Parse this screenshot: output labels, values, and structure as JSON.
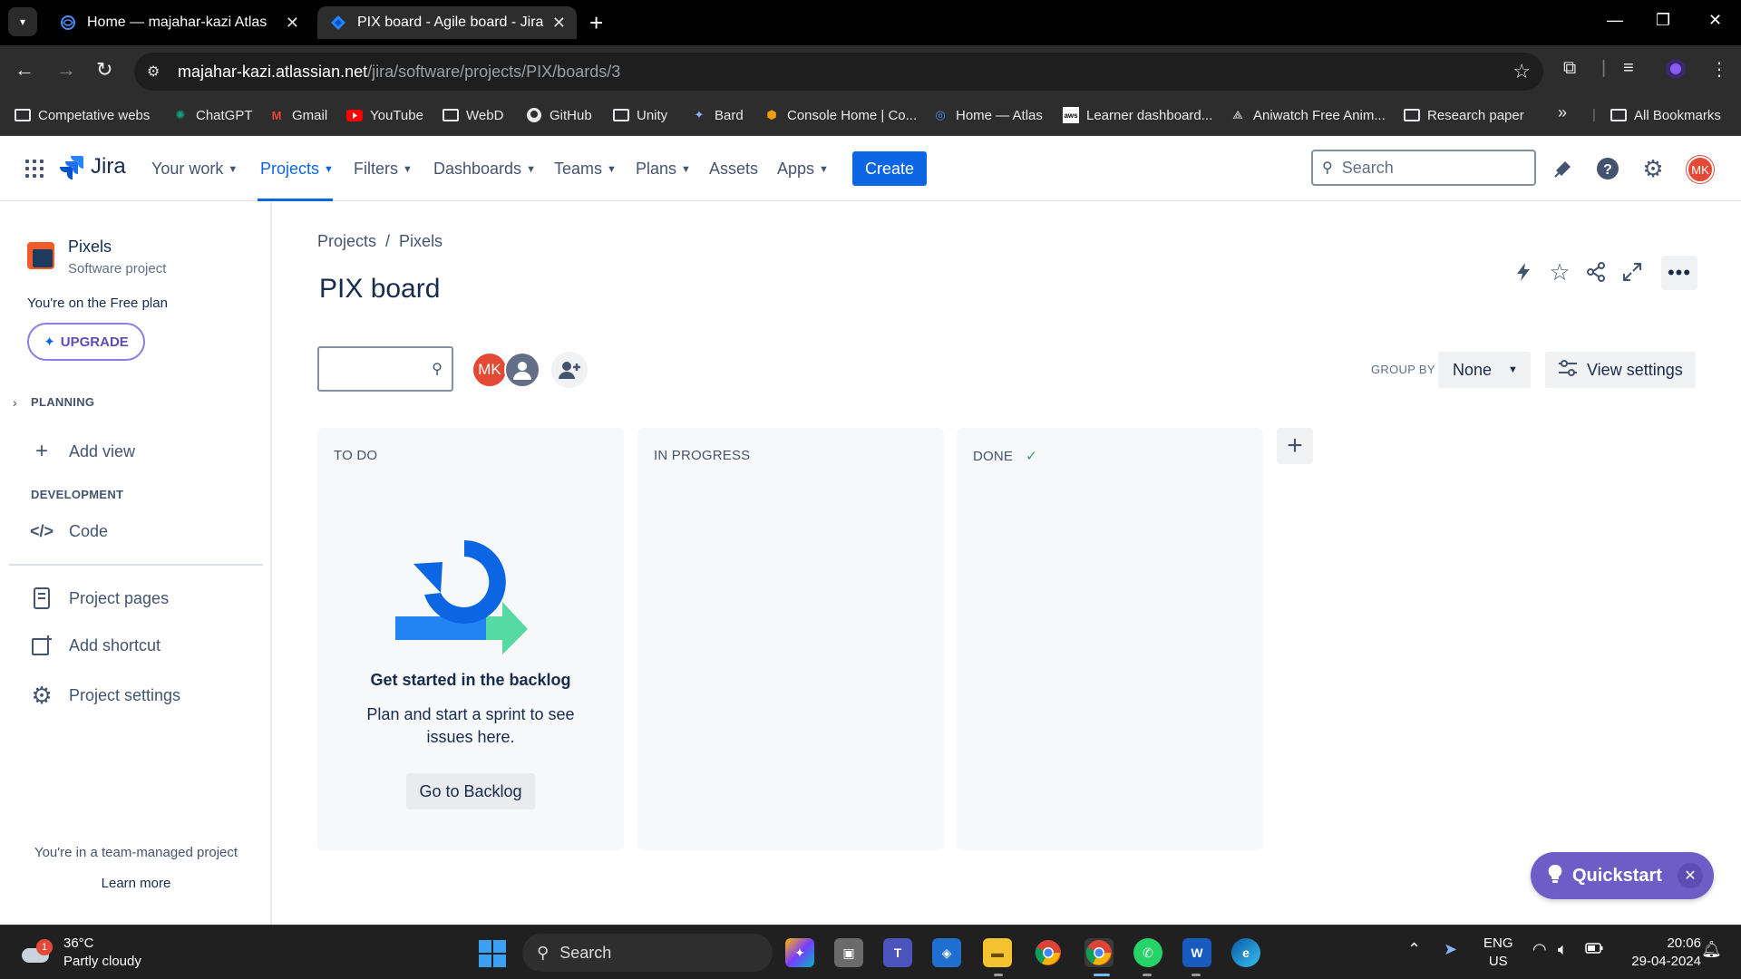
{
  "browser": {
    "tabs": [
      {
        "title": "Home — majahar-kazi Atlas",
        "active": false
      },
      {
        "title": "PIX board - Agile board - Jira",
        "active": true
      }
    ],
    "url_host": "majahar-kazi.atlassian.net",
    "url_path": "/jira/software/projects/PIX/boards/3",
    "bookmarks": [
      "Competative webs",
      "ChatGPT",
      "Gmail",
      "YouTube",
      "WebD",
      "GitHub",
      "Unity",
      "Bard",
      "Console Home | Co...",
      "Home — Atlas",
      "Learner dashboard...",
      "Aniwatch Free Anim...",
      "Research paper",
      "All Bookmarks"
    ],
    "bookmark_overflow": "»"
  },
  "jira_nav": {
    "logo": "Jira",
    "items": [
      "Your work",
      "Projects",
      "Filters",
      "Dashboards",
      "Teams",
      "Plans",
      "Assets",
      "Apps"
    ],
    "active_item": "Projects",
    "create_label": "Create",
    "search_placeholder": "Search",
    "avatar_initials": "MK"
  },
  "sidebar": {
    "project_name": "Pixels",
    "project_type": "Software project",
    "plan_text": "You're on the Free plan",
    "upgrade_label": "UPGRADE",
    "planning_header": "PLANNING",
    "add_view": "Add view",
    "development_header": "DEVELOPMENT",
    "code": "Code",
    "project_pages": "Project pages",
    "add_shortcut": "Add shortcut",
    "project_settings": "Project settings",
    "team_note": "You're in a team-managed project",
    "learn_more": "Learn more"
  },
  "main": {
    "breadcrumb": [
      "Projects",
      "Pixels"
    ],
    "title": "PIX board",
    "avatar_initials": "MK",
    "group_by_label": "GROUP BY",
    "group_by_value": "None",
    "view_settings": "View settings",
    "columns": [
      {
        "title": "TO DO",
        "done": false
      },
      {
        "title": "IN PROGRESS",
        "done": false
      },
      {
        "title": "DONE",
        "done": true
      }
    ],
    "empty_state": {
      "title": "Get started in the backlog",
      "description": "Plan and start a sprint to see issues here.",
      "button": "Go to Backlog"
    },
    "quickstart": "Quickstart"
  },
  "taskbar": {
    "temperature": "36°C",
    "weather": "Partly cloudy",
    "weather_badge": "1",
    "search": "Search",
    "lang_top": "ENG",
    "lang_bottom": "US",
    "time": "20:06",
    "date": "29-04-2024"
  },
  "colors": {
    "jira_blue": "#0c66e4",
    "quickstart_purple": "#6e5dc6",
    "avatar_red": "#e34935",
    "done_check": "#22a06b"
  }
}
